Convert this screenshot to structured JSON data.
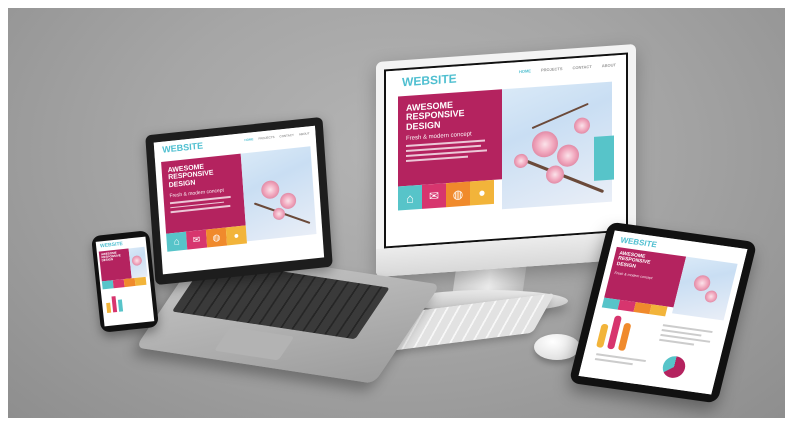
{
  "website": {
    "brand": "WEBSITE",
    "nav": [
      "HOME",
      "PROJECTS",
      "CONTACT",
      "ABOUT"
    ],
    "headline": "AWESOME\nRESPONSIVE\nDESIGN",
    "tagline": "Fresh & modern concept"
  },
  "colors": {
    "accent": "#4fbfd0",
    "hero": "#b4235f",
    "tiles": [
      "#57c4c9",
      "#d7356e",
      "#f08a2c",
      "#f2b43a"
    ]
  },
  "icons": [
    "home-icon",
    "mail-icon",
    "globe-icon",
    "user-icon"
  ]
}
